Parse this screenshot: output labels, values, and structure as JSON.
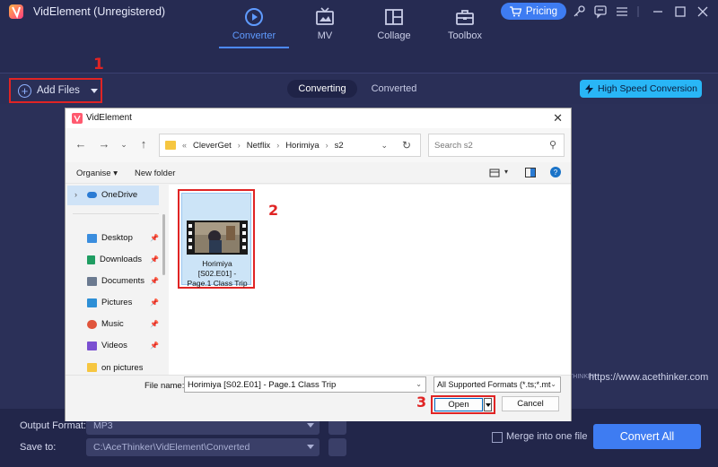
{
  "app": {
    "title": "VidElement (Unregistered)",
    "pricing_label": "Pricing",
    "brand_color": "#3e7cf2"
  },
  "nav": {
    "tabs": [
      {
        "label": "Converter",
        "icon": "converter-icon",
        "active": true
      },
      {
        "label": "MV",
        "icon": "mv-icon"
      },
      {
        "label": "Collage",
        "icon": "collage-icon"
      },
      {
        "label": "Toolbox",
        "icon": "toolbox-icon"
      }
    ]
  },
  "toolbar": {
    "add_files_label": "Add Files",
    "segments": [
      "Converting",
      "Converted"
    ],
    "high_speed_label": "High Speed Conversion"
  },
  "annotations": {
    "step1": "1",
    "step2": "2",
    "step3": "3"
  },
  "website": "https://www.acethinker.com",
  "website_prefix": "THINKER",
  "bottom": {
    "output_format_label": "Output Format:",
    "output_format_value": "MP3",
    "save_to_label": "Save to:",
    "save_to_value": "C:\\AceThinker\\VidElement\\Converted",
    "merge_label": "Merge into one file",
    "convert_all_label": "Convert All"
  },
  "dialog": {
    "title": "VidElement",
    "breadcrumb": [
      "CleverGet",
      "Netflix",
      "Horimiya",
      "s2"
    ],
    "search_placeholder": "Search s2",
    "organise_label": "Organise",
    "new_folder_label": "New folder",
    "sidebar": {
      "onedrive": "OneDrive",
      "items": [
        {
          "label": "Desktop",
          "icon": "desktop-icon"
        },
        {
          "label": "Downloads",
          "icon": "downloads-icon"
        },
        {
          "label": "Documents",
          "icon": "documents-icon"
        },
        {
          "label": "Pictures",
          "icon": "pictures-icon"
        },
        {
          "label": "Music",
          "icon": "music-icon"
        },
        {
          "label": "Videos",
          "icon": "videos-icon"
        },
        {
          "label": "on pictures",
          "icon": "folder-icon"
        }
      ]
    },
    "file": {
      "name_lines": [
        "Horimiya",
        "[S02.E01] -",
        "Page.1 Class Trip"
      ]
    },
    "file_name_label": "File name:",
    "file_name_value": "Horimiya [S02.E01] - Page.1 Class Trip",
    "file_type_value": "All Supported Formats (*.ts;*.mt",
    "open_label": "Open",
    "cancel_label": "Cancel"
  }
}
